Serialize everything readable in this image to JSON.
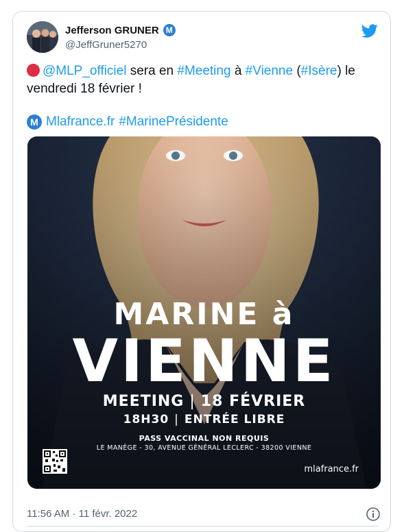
{
  "tweet": {
    "author_name": "Jefferson GRUNER",
    "author_handle": "@JeffGruner5270",
    "badge_letter": "M",
    "text": {
      "mention": "@MLP_officiel",
      "t1": " sera en ",
      "hashtag_meeting": "#Meeting",
      "t2": " à ",
      "hashtag_vienne": "#Vienne",
      "t3": " (",
      "hashtag_isere": "#Isère",
      "t4": ") le vendredi 18 février !"
    },
    "line2": {
      "emoji_letter": "M",
      "link": "Mlafrance.fr",
      "hashtag": "#MarinePrésidente"
    },
    "timestamp": "11:56 AM · 11 févr. 2022"
  },
  "poster": {
    "title_line1": "MARINE à",
    "title_line2": "VIENNE",
    "meeting": "MEETING",
    "date": "18 FÉVRIER",
    "time": "18H30",
    "entry": "ENTRÉE LIBRE",
    "pass": "PASS VACCINAL NON REQUIS",
    "address": "LE MANÈGE - 30, AVENUE GÉNÉRAL LECLERC - 38200 VIENNE",
    "site": "mlafrance.fr"
  },
  "colors": {
    "link": "#1d9bf0",
    "badge": "#2b7fd6",
    "red_dot": "#dd2e44",
    "poster_bg": "#1a2333"
  },
  "icons": [
    "twitter-bird-icon",
    "info-icon",
    "verified-m-badge-icon",
    "qr-code-icon"
  ]
}
